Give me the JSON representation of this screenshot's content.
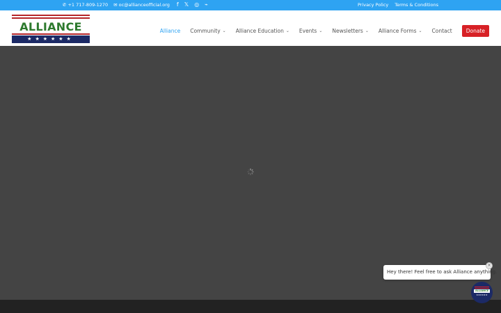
{
  "topbar": {
    "phone_icon": "phone-icon",
    "phone": "+1 717-809-1270",
    "email_icon": "envelope-icon",
    "email": "oc@allianceofficial.org",
    "social": [
      {
        "icon": "facebook-icon",
        "glyph": "f"
      },
      {
        "icon": "x-icon",
        "glyph": "𝕏"
      },
      {
        "icon": "instagram-icon",
        "glyph": "◎"
      },
      {
        "icon": "rss-icon",
        "glyph": "⌁"
      }
    ],
    "links": [
      "Privacy Policy",
      "Terms & Conditions"
    ]
  },
  "logo": {
    "word": "ALLIANCE",
    "stars": "★★★★★★"
  },
  "nav": {
    "items": [
      {
        "label": "Alliance",
        "active": true,
        "dropdown": false
      },
      {
        "label": "Community",
        "dropdown": true
      },
      {
        "label": "Alliance Education",
        "dropdown": true
      },
      {
        "label": "Events",
        "dropdown": true
      },
      {
        "label": "Newsletters",
        "dropdown": true
      },
      {
        "label": "Alliance Forms",
        "dropdown": true
      },
      {
        "label": "Contact",
        "dropdown": false
      }
    ],
    "donate": "Donate",
    "chevron_glyph": "⌄"
  },
  "chat": {
    "message": "Hey there! Feel free to ask Alliance anything.",
    "close_glyph": "×",
    "launcher_word": "ALLIANCE",
    "launcher_stars": "★★★★★★"
  },
  "colors": {
    "topbar": "#2ea3f2",
    "accent": "#2ea3f2",
    "donate": "#d72126",
    "overlay": "#444444",
    "logo_red": "#b52428",
    "logo_green": "#2d7a2e",
    "logo_navy": "#1c2a66"
  }
}
